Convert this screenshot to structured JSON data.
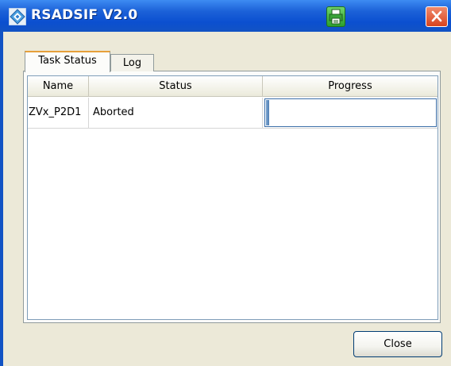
{
  "window": {
    "title": "RSADSIF V2.0",
    "icons": {
      "app": "app-logo-icon",
      "print": "printer-icon",
      "close": "close-icon"
    },
    "colors": {
      "titlebar": "#0b4fd0",
      "close_button": "#d9441e",
      "print_button": "#2ca02c",
      "window_bg": "#ece9d8",
      "active_tab_accent": "#e6a03a"
    }
  },
  "tabs": [
    {
      "label": "Task Status",
      "active": true
    },
    {
      "label": "Log",
      "active": false
    }
  ],
  "table": {
    "columns": [
      "Name",
      "Status",
      "Progress"
    ],
    "rows": [
      {
        "name": "ZVx_P2D1",
        "status": "Aborted",
        "progress": 0.02
      }
    ]
  },
  "buttons": {
    "close_label": "Close"
  }
}
